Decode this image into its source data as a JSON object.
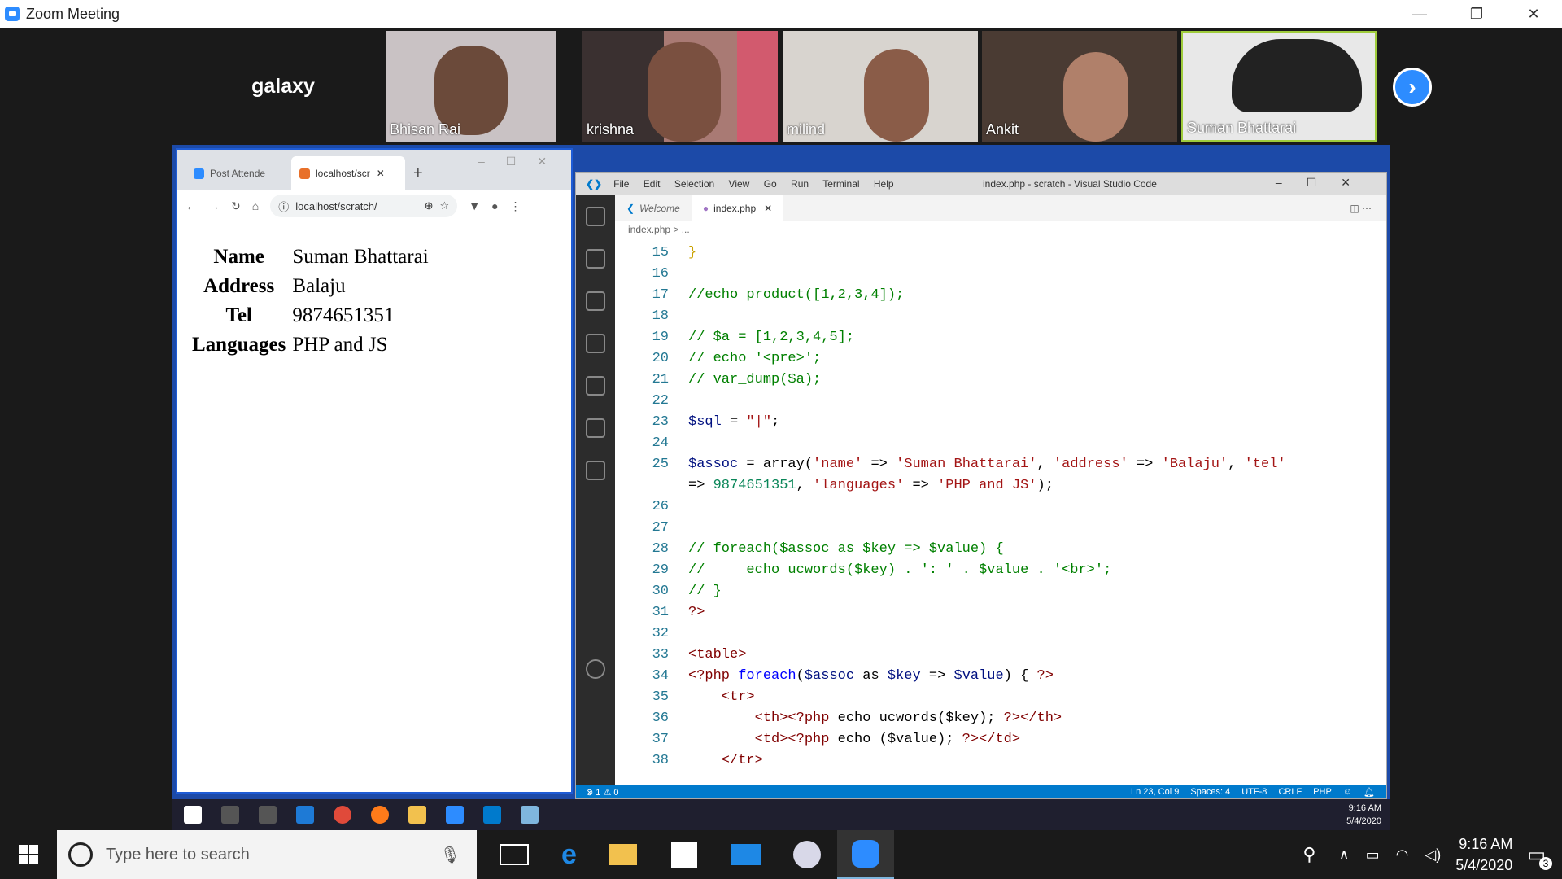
{
  "zoom": {
    "title": "Zoom Meeting"
  },
  "participants": [
    {
      "name": "galaxy"
    },
    {
      "name": "Bhisan Rai"
    },
    {
      "name": "krishna"
    },
    {
      "name": "milind"
    },
    {
      "name": "Ankit"
    },
    {
      "name": "Suman Bhattarai"
    }
  ],
  "chrome": {
    "tabs": [
      {
        "label": "Post Attende"
      },
      {
        "label": "localhost/scr"
      }
    ],
    "url": "localhost/scratch/",
    "table": [
      {
        "key": "Name",
        "value": "Suman Bhattarai"
      },
      {
        "key": "Address",
        "value": "Balaju"
      },
      {
        "key": "Tel",
        "value": "9874651351"
      },
      {
        "key": "Languages",
        "value": "PHP and JS"
      }
    ]
  },
  "vscode": {
    "menu": [
      "File",
      "Edit",
      "Selection",
      "View",
      "Go",
      "Run",
      "Terminal",
      "Help"
    ],
    "title": "index.php - scratch - Visual Studio Code",
    "tabs": [
      {
        "label": "Welcome"
      },
      {
        "label": "index.php"
      }
    ],
    "breadcrumb": "index.php > ...",
    "status": {
      "problems": "⊗ 1 ⚠ 0",
      "position": "Ln 23, Col 9",
      "spaces": "Spaces: 4",
      "encoding": "UTF-8",
      "eol": "CRLF",
      "language": "PHP"
    }
  },
  "inner_taskbar": {
    "time": "9:16 AM",
    "date": "5/4/2020"
  },
  "taskbar": {
    "search_placeholder": "Type here to search",
    "time": "9:16 AM",
    "date": "5/4/2020",
    "notifications": "3"
  }
}
